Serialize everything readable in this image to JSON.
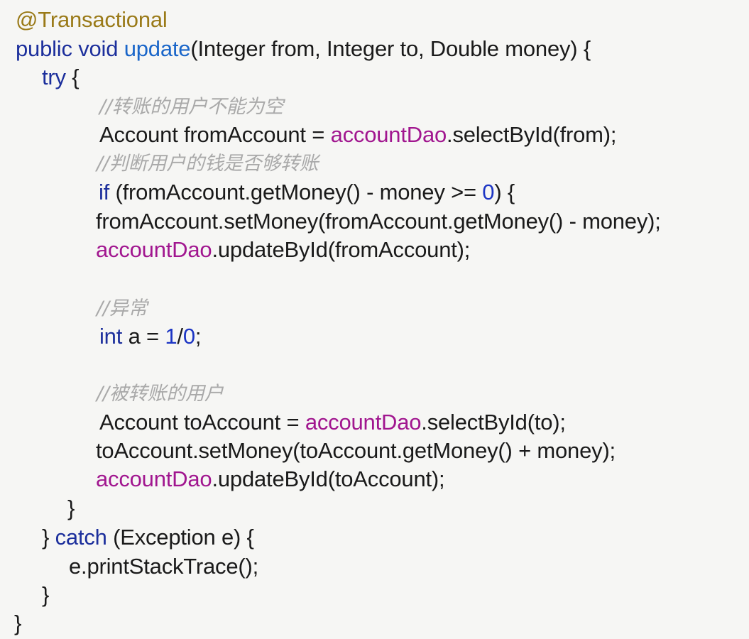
{
  "annotation": "@Transactional",
  "method": {
    "modifiers": "public void",
    "name": "update",
    "params": "(Integer from, Integer to, Double money) {"
  },
  "try_open": {
    "kw": "try",
    "rest": " {"
  },
  "comment_1": "//转账的用户不能为空",
  "line_from_account": {
    "a": "Account fromAccount = ",
    "dao": "accountDao",
    "b": ".selectById(from);"
  },
  "comment_2": "//判断用户的钱是否够转账",
  "line_if": {
    "kw": "if",
    "a": " (fromAccount.getMoney() - money >= ",
    "num": "0",
    "b": ") {"
  },
  "line_set_from": "fromAccount.setMoney(fromAccount.getMoney() - money);",
  "line_update_from": {
    "dao": "accountDao",
    "b": ".updateById(fromAccount);"
  },
  "comment_3": "//异常",
  "line_int": {
    "kw": "int",
    "a": " a = ",
    "num1": "1",
    "slash": "/",
    "num2": "0",
    "b": ";"
  },
  "comment_4": "//被转账的用户",
  "line_to_account": {
    "a": "Account toAccount = ",
    "dao": "accountDao",
    "b": ".selectById(to);"
  },
  "line_set_to": "toAccount.setMoney(toAccount.getMoney() + money);",
  "line_update_to": {
    "dao": "accountDao",
    "b": ".updateById(toAccount);"
  },
  "close_if": "}",
  "catch_line": {
    "a": "} ",
    "kw": "catch",
    "b": " (Exception e) {"
  },
  "print_stack": "e.printStackTrace();",
  "close_catch": "}",
  "close_method": "}"
}
